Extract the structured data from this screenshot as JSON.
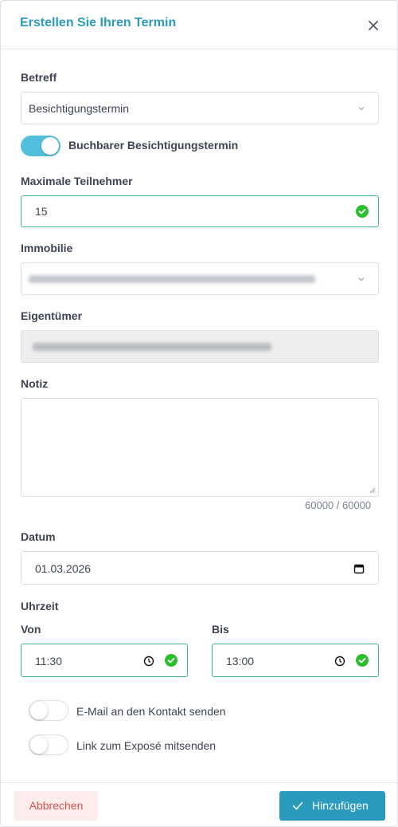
{
  "dialog": {
    "title": "Erstellen Sie Ihren Termin"
  },
  "betreff": {
    "label": "Betreff",
    "value": "Besichtigungstermin"
  },
  "bookable": {
    "label": "Buchbarer Besichtigungstermin",
    "on": true
  },
  "max_participants": {
    "label": "Maximale Teilnehmer",
    "value": "15"
  },
  "immobilie": {
    "label": "Immobilie"
  },
  "owner": {
    "label": "Eigentümer"
  },
  "note": {
    "label": "Notiz",
    "counter": "60000 / 60000"
  },
  "date": {
    "label": "Datum",
    "value": "01.03.2026"
  },
  "time": {
    "label": "Uhrzeit",
    "from_label": "Von",
    "from_value": "11:30",
    "to_label": "Bis",
    "to_value": "13:00"
  },
  "options": {
    "email_label": "E-Mail an den Kontakt senden",
    "email_on": false,
    "expose_label": "Link zum Exposé mitsenden",
    "expose_on": false
  },
  "footer": {
    "cancel_label": "Abbrechen",
    "add_label": "Hinzufügen"
  },
  "colors": {
    "accent": "#2a9bbd",
    "toggle_on": "#51bfdb",
    "valid": "#3fb58f",
    "cancel_text": "#d9534f",
    "check_green": "#2bc02b"
  },
  "icons": [
    "close-icon",
    "chevron-down-icon",
    "check-circle-icon",
    "calendar-icon",
    "clock-icon",
    "checkmark-icon",
    "resize-handle-icon"
  ]
}
